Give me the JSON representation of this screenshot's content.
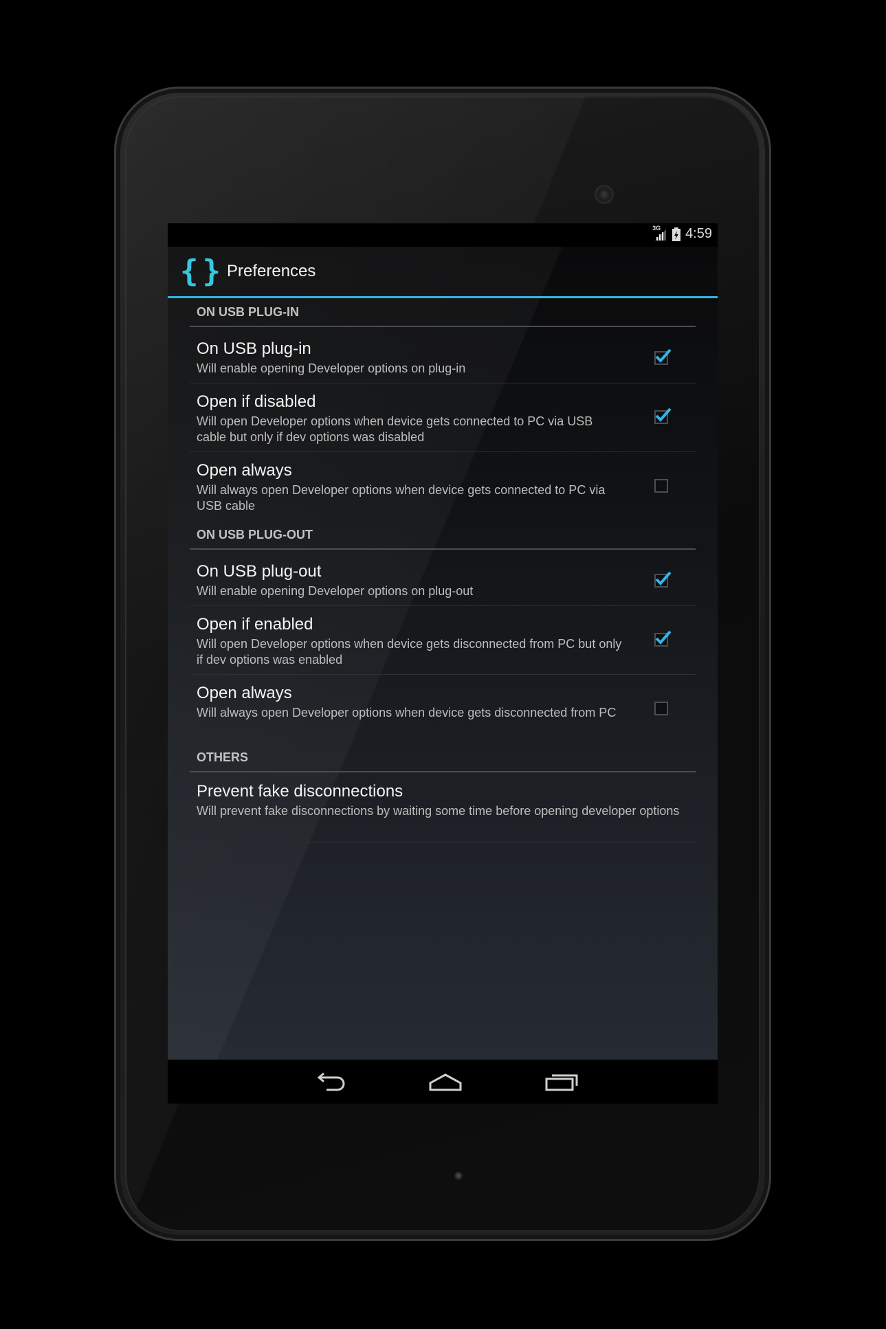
{
  "status_bar": {
    "network": "3G",
    "time": "4:59"
  },
  "action_bar": {
    "app_icon": "curly-braces-icon",
    "title": "Preferences",
    "accent_color": "#33b5e5"
  },
  "sections": [
    {
      "header": "ON USB PLUG-IN",
      "items": [
        {
          "title": "On USB plug-in",
          "summary": "Will enable opening Developer options on plug-in",
          "checked": true
        },
        {
          "title": "Open if disabled",
          "summary": "Will open Developer options when device gets connected to PC via USB cable but only if dev options was disabled",
          "checked": true
        },
        {
          "title": "Open always",
          "summary": "Will always open Developer options when device gets connected to PC via USB cable",
          "checked": false
        }
      ]
    },
    {
      "header": "ON USB PLUG-OUT",
      "items": [
        {
          "title": "On USB plug-out",
          "summary": "Will enable opening Developer options on plug-out",
          "checked": true
        },
        {
          "title": "Open if enabled",
          "summary": "Will open Developer options when device gets disconnected from PC but only if dev options was enabled",
          "checked": true
        },
        {
          "title": "Open always",
          "summary": "Will always open Developer options when device gets disconnected from PC",
          "checked": false
        }
      ]
    },
    {
      "header": "OTHERS",
      "items": [
        {
          "title": "Prevent fake disconnections",
          "summary": "Will prevent fake disconnections by waiting some time before opening developer options"
        }
      ]
    }
  ],
  "nav_bar": {
    "back": "back-icon",
    "home": "home-icon",
    "recents": "recents-icon"
  }
}
